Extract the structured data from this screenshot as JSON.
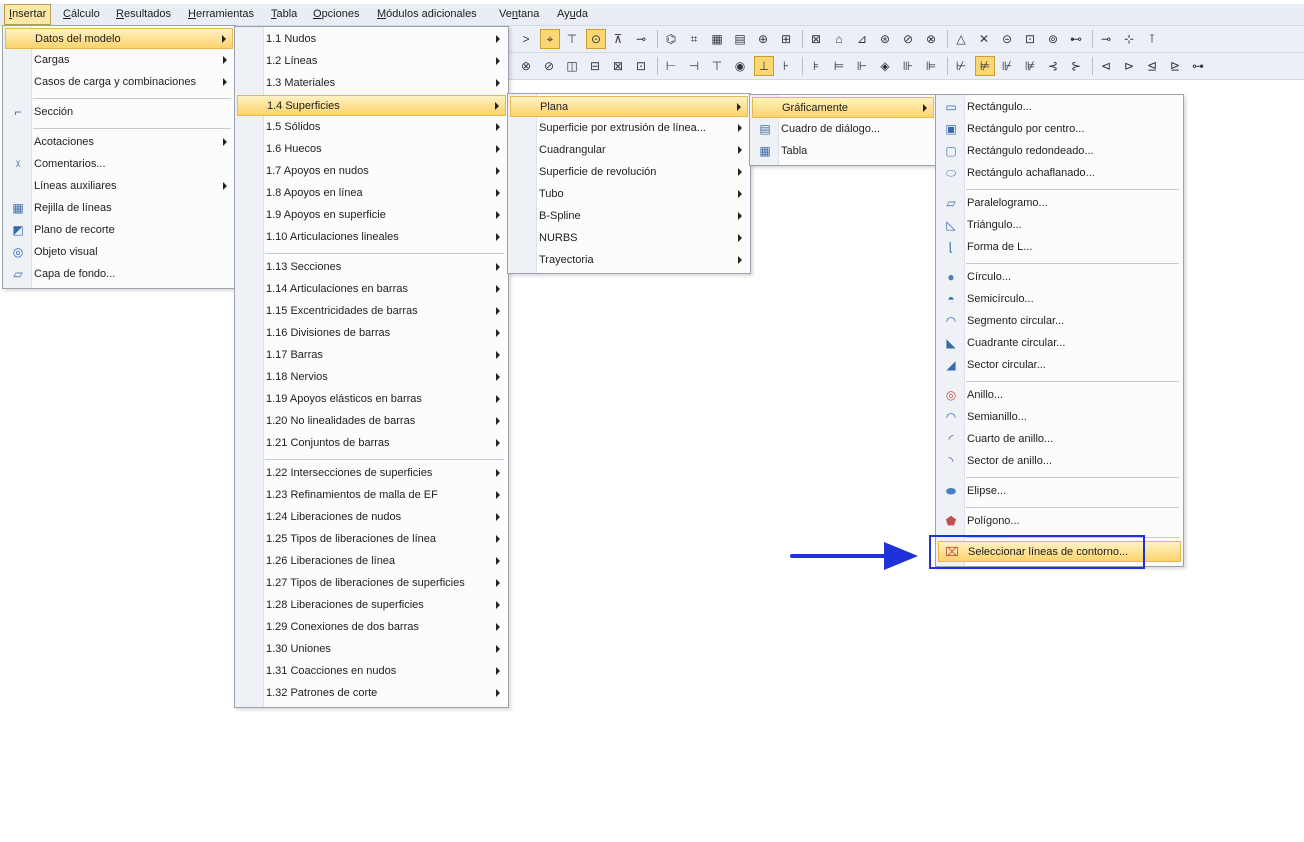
{
  "menubar": [
    {
      "label": "Insertar",
      "ul": "I",
      "rest": "nsertar"
    },
    {
      "label": "Cálculo",
      "ul": "C",
      "rest": "álculo"
    },
    {
      "label": "Resultados",
      "ul": "R",
      "rest": "esultados"
    },
    {
      "label": "Herramientas",
      "ul": "H",
      "rest": "erramientas"
    },
    {
      "label": "Tabla",
      "ul": "T",
      "rest": "abla"
    },
    {
      "label": "Opciones",
      "ul": "O",
      "rest": "pciones"
    },
    {
      "label": "Módulos adicionales",
      "ul": "M",
      "rest": "ódulos adicionales"
    },
    {
      "label": "Ventana",
      "pre": "Ve",
      "ul": "n",
      "rest": "tana"
    },
    {
      "label": "Ayuda",
      "pre": "Ay",
      "ul": "u",
      "rest": "da"
    }
  ],
  "menu1": {
    "items": [
      {
        "label": "Datos del modelo",
        "sub": true,
        "sel": true
      },
      {
        "label": "Cargas",
        "sub": true
      },
      {
        "label": "Casos de carga y combinaciones",
        "sub": true
      },
      {
        "sep": true
      },
      {
        "label": "Sección",
        "icon": "section-icon"
      },
      {
        "sep": true
      },
      {
        "label": "Acotaciones",
        "sub": true
      },
      {
        "label": "Comentarios...",
        "icon": "comment-icon"
      },
      {
        "label": "Líneas auxiliares",
        "sub": true
      },
      {
        "label": "Rejilla de líneas",
        "icon": "grid-icon"
      },
      {
        "label": "Plano de recorte",
        "icon": "clip-plane-icon"
      },
      {
        "label": "Objeto visual",
        "icon": "visual-object-icon"
      },
      {
        "label": "Capa de fondo...",
        "icon": "background-layer-icon"
      }
    ]
  },
  "menu2": {
    "items": [
      {
        "label": "1.1 Nudos",
        "sub": true
      },
      {
        "label": "1.2 Líneas",
        "sub": true
      },
      {
        "label": "1.3 Materiales",
        "sub": true
      },
      {
        "label": "1.4 Superficies",
        "sub": true,
        "sel": true
      },
      {
        "label": "1.5 Sólidos",
        "sub": true
      },
      {
        "label": "1.6 Huecos",
        "sub": true
      },
      {
        "label": "1.7 Apoyos en nudos",
        "sub": true
      },
      {
        "label": "1.8 Apoyos en línea",
        "sub": true
      },
      {
        "label": "1.9 Apoyos en superficie",
        "sub": true
      },
      {
        "label": "1.10 Articulaciones lineales",
        "sub": true
      },
      {
        "sep": true
      },
      {
        "label": "1.13 Secciones",
        "sub": true
      },
      {
        "label": "1.14 Articulaciones en barras",
        "sub": true
      },
      {
        "label": "1.15 Excentricidades de barras",
        "sub": true
      },
      {
        "label": "1.16 Divisiones de barras",
        "sub": true
      },
      {
        "label": "1.17 Barras",
        "sub": true
      },
      {
        "label": "1.18 Nervios",
        "sub": true
      },
      {
        "label": "1.19 Apoyos elásticos en barras",
        "sub": true
      },
      {
        "label": "1.20 No linealidades de barras",
        "sub": true
      },
      {
        "label": "1.21 Conjuntos de barras",
        "sub": true
      },
      {
        "sep": true
      },
      {
        "label": "1.22 Intersecciones de superficies",
        "sub": true
      },
      {
        "label": "1.23 Refinamientos de malla de EF",
        "sub": true
      },
      {
        "label": "1.24 Liberaciones de nudos",
        "sub": true
      },
      {
        "label": "1.25 Tipos de liberaciones de línea",
        "sub": true
      },
      {
        "label": "1.26 Liberaciones de línea",
        "sub": true
      },
      {
        "label": "1.27 Tipos de liberaciones de superficies",
        "sub": true
      },
      {
        "label": "1.28 Liberaciones de superficies",
        "sub": true
      },
      {
        "label": "1.29 Conexiones de dos barras",
        "sub": true
      },
      {
        "label": "1.30 Uniones",
        "sub": true
      },
      {
        "label": "1.31 Coacciones en nudos",
        "sub": true
      },
      {
        "label": "1.32 Patrones de corte",
        "sub": true
      }
    ]
  },
  "menu3": {
    "items": [
      {
        "label": "Plana",
        "sub": true,
        "sel": true
      },
      {
        "label": "Superficie por extrusión de línea...",
        "sub": true
      },
      {
        "label": "Cuadrangular",
        "sub": true
      },
      {
        "label": "Superficie de revolución",
        "sub": true
      },
      {
        "label": "Tubo",
        "sub": true
      },
      {
        "label": "B-Spline",
        "sub": true
      },
      {
        "label": "NURBS",
        "sub": true
      },
      {
        "label": "Trayectoria",
        "sub": true
      }
    ]
  },
  "menu4": {
    "items": [
      {
        "label": "Gráficamente",
        "sub": true,
        "sel": true
      },
      {
        "label": "Cuadro de diálogo...",
        "icon": "dialog-icon"
      },
      {
        "label": "Tabla",
        "icon": "table-icon"
      }
    ]
  },
  "menu5": {
    "items": [
      {
        "label": "Rectángulo...",
        "icon": "rectangle-icon"
      },
      {
        "label": "Rectángulo por centro...",
        "icon": "rectangle-center-icon"
      },
      {
        "label": "Rectángulo redondeado...",
        "icon": "rounded-rectangle-icon"
      },
      {
        "label": "Rectángulo achaflanado...",
        "icon": "chamfered-rectangle-icon"
      },
      {
        "sep": true
      },
      {
        "label": "Paralelogramo...",
        "icon": "parallelogram-icon"
      },
      {
        "label": "Triángulo...",
        "icon": "triangle-icon"
      },
      {
        "label": "Forma de L...",
        "icon": "l-shape-icon"
      },
      {
        "sep": true
      },
      {
        "label": "Círculo...",
        "icon": "circle-icon"
      },
      {
        "label": "Semicírculo...",
        "icon": "semicircle-icon"
      },
      {
        "label": "Segmento circular...",
        "icon": "circular-segment-icon"
      },
      {
        "label": "Cuadrante circular...",
        "icon": "circular-quadrant-icon"
      },
      {
        "label": "Sector circular...",
        "icon": "circular-sector-icon"
      },
      {
        "sep": true
      },
      {
        "label": "Anillo...",
        "icon": "ring-icon"
      },
      {
        "label": "Semianillo...",
        "icon": "half-ring-icon"
      },
      {
        "label": "Cuarto de anillo...",
        "icon": "quarter-ring-icon"
      },
      {
        "label": "Sector de anillo...",
        "icon": "ring-sector-icon"
      },
      {
        "sep": true
      },
      {
        "label": "Elipse...",
        "icon": "ellipse-icon"
      },
      {
        "sep": true
      },
      {
        "label": "Polígono...",
        "icon": "polygon-icon"
      },
      {
        "sep": true
      },
      {
        "label": "Seleccionar líneas de contorno...",
        "icon": "select-boundary-lines-icon",
        "sel": true
      }
    ]
  },
  "colors": {
    "accent_box": "#1f31d9",
    "arrow": "#1f31d9",
    "selection": "#fbd36b"
  }
}
